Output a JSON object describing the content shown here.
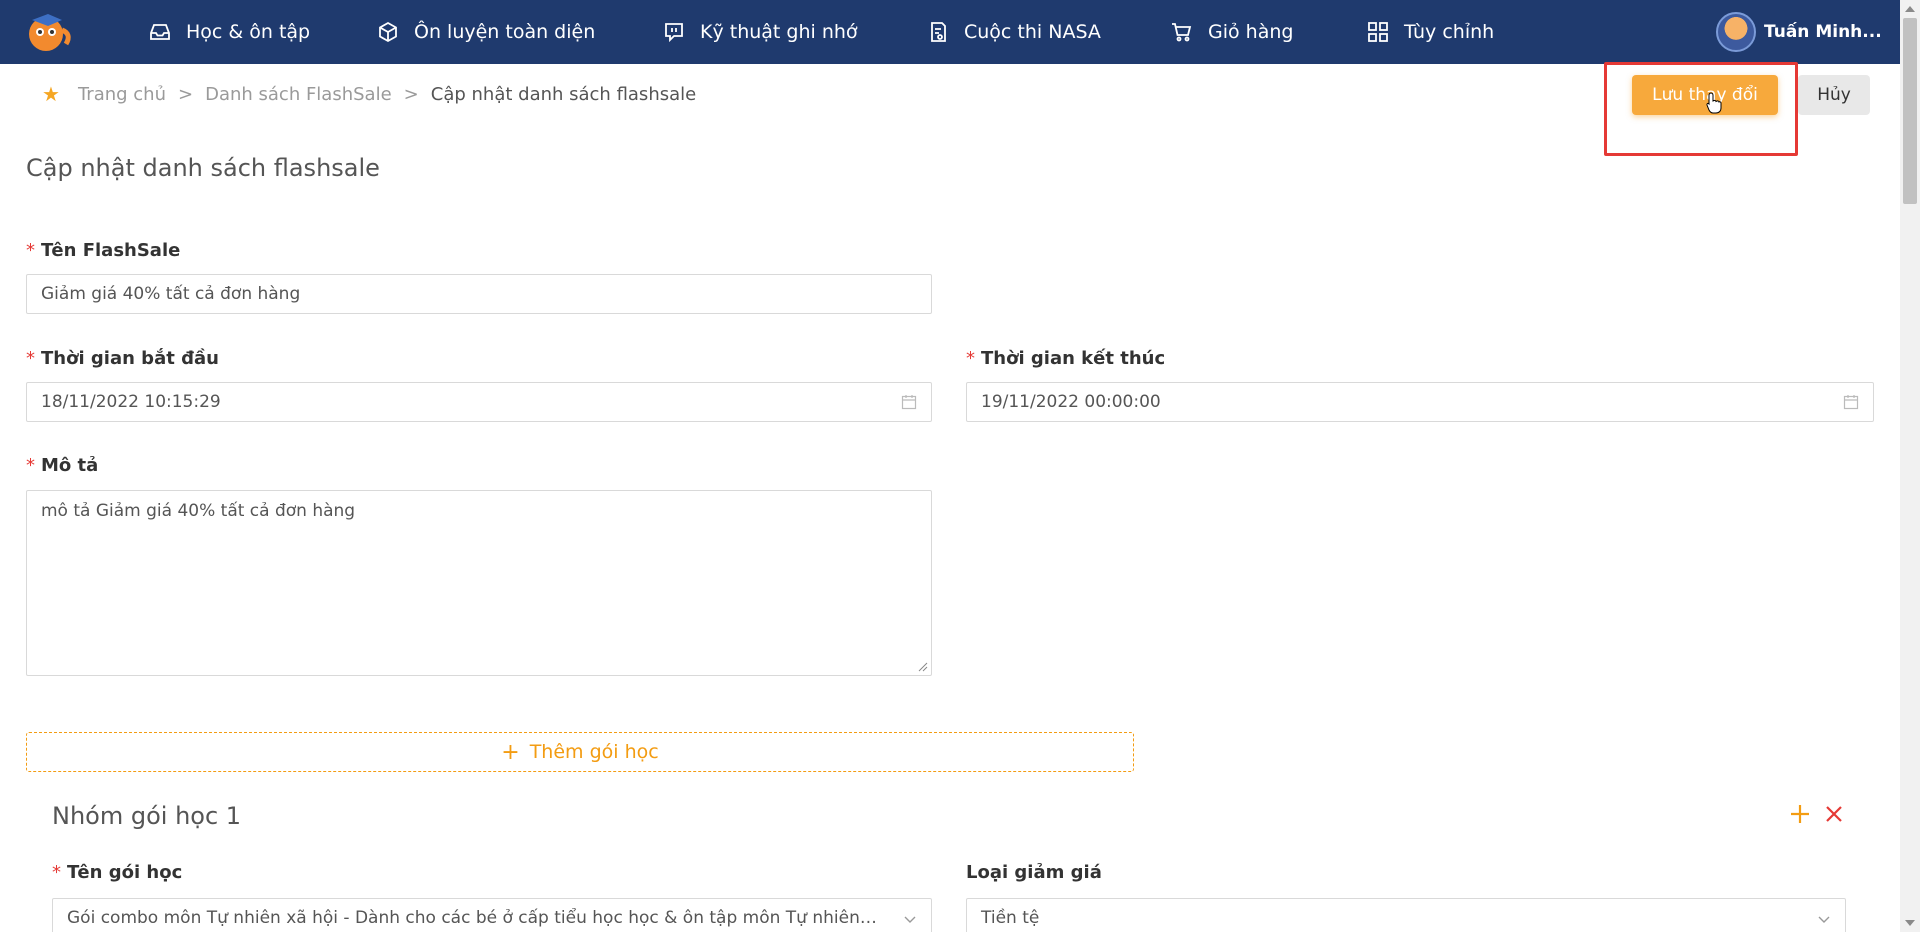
{
  "nav": {
    "items": [
      {
        "label": "Học & ôn tập",
        "icon": "inbox-icon"
      },
      {
        "label": "Ôn luyện toàn diện",
        "icon": "box-icon"
      },
      {
        "label": "Kỹ thuật ghi nhớ",
        "icon": "chat-icon"
      },
      {
        "label": "Cuộc thi NASA",
        "icon": "certificate-icon"
      },
      {
        "label": "Giỏ hàng",
        "icon": "cart-icon"
      },
      {
        "label": "Tùy chỉnh",
        "icon": "grid-icon"
      }
    ],
    "user_name": "Tuấn Minh..."
  },
  "breadcrumb": {
    "home": "Trang chủ",
    "list": "Danh sách FlashSale",
    "current": "Cập nhật danh sách flashsale"
  },
  "actions": {
    "save_label": "Lưu thay đổi",
    "cancel_label": "Hủy"
  },
  "page_title": "Cập nhật danh sách flashsale",
  "form": {
    "name_label": "Tên FlashSale",
    "name_value": "Giảm giá 40% tất cả đơn hàng",
    "start_label": "Thời gian bắt đầu",
    "start_value": "18/11/2022 10:15:29",
    "end_label": "Thời gian kết thúc",
    "end_value": "19/11/2022 00:00:00",
    "desc_label": "Mô tả",
    "desc_value": "mô tả Giảm giá 40% tất cả đơn hàng",
    "add_course_label": "Thêm gói học"
  },
  "group": {
    "title": "Nhóm gói học 1",
    "course_label": "Tên gói học",
    "course_value": "Gói combo môn Tự nhiên xã hội - Dành cho các bé ở cấp tiểu học học & ôn tập môn Tự nhiên xã hội",
    "discount_type_label": "Loại giảm giá",
    "discount_type_value": "Tiền tệ"
  },
  "colors": {
    "nav_bg": "#1f3a6e",
    "accent": "#f7a93c",
    "required": "#e53935",
    "highlight": "#e53935"
  }
}
